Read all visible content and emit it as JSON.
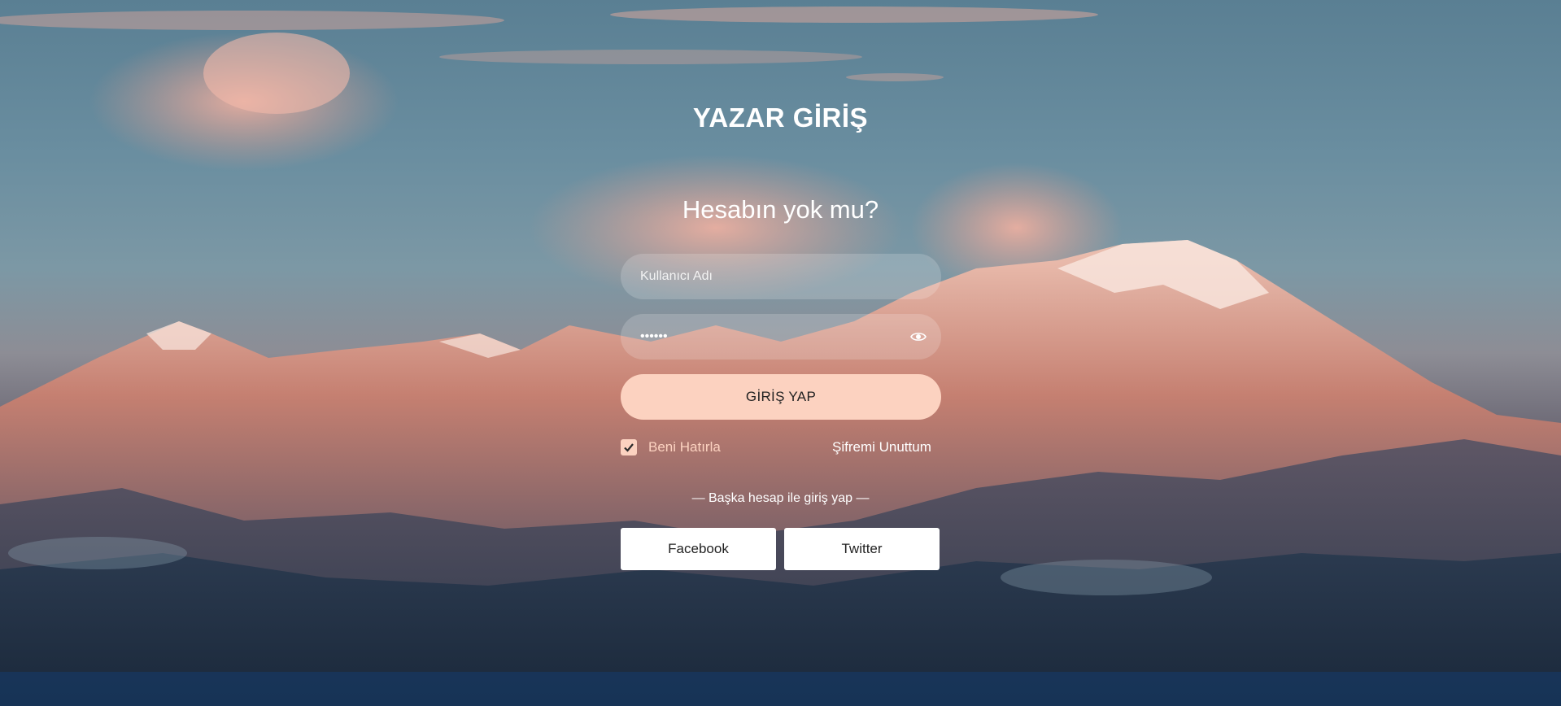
{
  "login": {
    "title": "YAZAR GİRİŞ",
    "subtitle": "Hesabın yok mu?",
    "username_placeholder": "Kullanıcı Adı",
    "password_value": "******",
    "submit_label": "GİRİŞ YAP",
    "remember_label": "Beni Hatırla",
    "remember_checked": true,
    "forgot_label": "Şifremi Unuttum",
    "other_login_label": "— Başka hesap ile giriş yap —",
    "facebook_label": "Facebook",
    "twitter_label": "Twitter"
  },
  "icons": {
    "password_toggle": "eye-icon",
    "remember_check": "checkmark-icon"
  },
  "colors": {
    "accent": "#fcd2c0",
    "text": "#ffffff",
    "button_text": "#222222"
  }
}
